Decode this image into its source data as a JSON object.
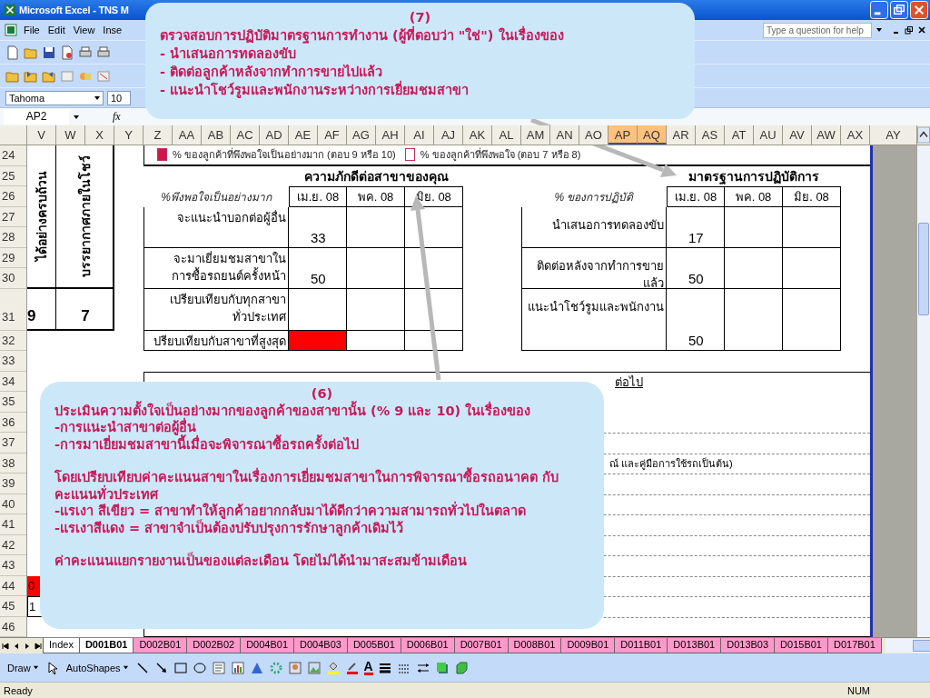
{
  "window": {
    "title": "Microsoft Excel - TNS M"
  },
  "menu": [
    "File",
    "Edit",
    "View",
    "Inse"
  ],
  "help_box": {
    "placeholder": "Type a question for help"
  },
  "formatting": {
    "font": "Tahoma",
    "size": "10"
  },
  "formula_bar": {
    "name_box": "AP2",
    "function_label": "fx"
  },
  "columns": [
    {
      "label": "V",
      "selected": false
    },
    {
      "label": "W",
      "selected": false
    },
    {
      "label": "X",
      "selected": false
    },
    {
      "label": "Y",
      "selected": false
    },
    {
      "label": "Z",
      "selected": false
    },
    {
      "label": "AA",
      "selected": false
    },
    {
      "label": "AB",
      "selected": false
    },
    {
      "label": "AC",
      "selected": false
    },
    {
      "label": "AD",
      "selected": false
    },
    {
      "label": "AE",
      "selected": false
    },
    {
      "label": "AF",
      "selected": false
    },
    {
      "label": "AG",
      "selected": false
    },
    {
      "label": "AH",
      "selected": false
    },
    {
      "label": "AI",
      "selected": false
    },
    {
      "label": "AJ",
      "selected": false
    },
    {
      "label": "AK",
      "selected": false
    },
    {
      "label": "AL",
      "selected": false
    },
    {
      "label": "AM",
      "selected": false
    },
    {
      "label": "AN",
      "selected": false
    },
    {
      "label": "AO",
      "selected": false
    },
    {
      "label": "AP",
      "selected": true
    },
    {
      "label": "AQ",
      "selected": true
    },
    {
      "label": "AR",
      "selected": false
    },
    {
      "label": "AS",
      "selected": false
    },
    {
      "label": "AT",
      "selected": false
    },
    {
      "label": "AU",
      "selected": false
    },
    {
      "label": "AV",
      "selected": false
    },
    {
      "label": "AW",
      "selected": false
    },
    {
      "label": "AX",
      "selected": false
    },
    {
      "label": "AY",
      "selected": false
    }
  ],
  "rows": [
    "24",
    "25",
    "26",
    "27",
    "28",
    "29",
    "30",
    "31",
    "32",
    "33",
    "34",
    "35",
    "36",
    "37",
    "38",
    "39",
    "40",
    "41",
    "42",
    "43",
    "44",
    "45",
    "46"
  ],
  "summary_box": {
    "headings": [
      "ได้อย่างครบถ้วน",
      "บรรยากาศภายในโชว์"
    ],
    "values": [
      "9",
      "7"
    ]
  },
  "legend": [
    {
      "label": "% ของลูกค้าที่พึงพอใจเป็นอย่างมาก (ตอบ 9 หรือ 10)",
      "filled": true
    },
    {
      "label": "% ของลูกค้าที่พึงพอใจ (ตอบ 7 หรือ 8)",
      "filled": false
    }
  ],
  "loyalty_table": {
    "title": "ความภักดีต่อสาขาของคุณ",
    "caption": "%พึงพอใจเป็นอย่างมาก",
    "months": [
      "เม.ย. 08",
      "พค. 08",
      "มิย. 08"
    ],
    "rows": [
      {
        "lines": [
          "จะแนะนำบอกต่อผู้อื่น"
        ],
        "value": "33"
      },
      {
        "lines": [
          "จะมาเยี่ยมชมสาขาใน",
          "การซื้อรถยนต์ครั้งหน้า"
        ],
        "value": "50"
      },
      {
        "lines": [
          "เปรียบเทียบกับทุกสาขา",
          "ทั่วประเทศ"
        ]
      },
      {
        "lines": [
          "ปรียบเทียบกับสาขาที่สูงสุด"
        ],
        "color": "#ff0000"
      }
    ]
  },
  "standards_table": {
    "title": "มาตรฐานการปฏิบัติการ",
    "caption": "% ของการปฏิบัติ",
    "months": [
      "เม.ย. 08",
      "พค. 08",
      "มิย. 08"
    ],
    "rows": [
      {
        "lines": [
          "นำเสนอการทดลองขับ"
        ],
        "value": "17"
      },
      {
        "lines": [
          "ติดต่อหลังจากทำการขาย",
          "แล้ว"
        ],
        "value": "50"
      },
      {
        "lines": [
          "แนะนำโชว์รูมและพนักงาน"
        ],
        "value": "50"
      }
    ]
  },
  "notes_box": {
    "heading": "ต่อไป",
    "fragment": "ณ์ และคู่มือการใช้รถเป็นต้น)"
  },
  "side_cells": [
    {
      "text": "0",
      "color": "#ff0000"
    },
    {
      "text": "1",
      "color": "#ffffff"
    }
  ],
  "sheet_tabs": [
    {
      "label": "Index",
      "selected": false,
      "color": "#ffffff"
    },
    {
      "label": "D001B01",
      "selected": true,
      "color": "#ffffff"
    },
    {
      "label": "D002B01",
      "selected": false,
      "color": "#ff99cc"
    },
    {
      "label": "D002B02",
      "selected": false,
      "color": "#ff99cc"
    },
    {
      "label": "D004B01",
      "selected": false,
      "color": "#ff99cc"
    },
    {
      "label": "D004B03",
      "selected": false,
      "color": "#ff99cc"
    },
    {
      "label": "D005B01",
      "selected": false,
      "color": "#ff99cc"
    },
    {
      "label": "D006B01",
      "selected": false,
      "color": "#ff99cc"
    },
    {
      "label": "D007B01",
      "selected": false,
      "color": "#ff99cc"
    },
    {
      "label": "D008B01",
      "selected": false,
      "color": "#ff99cc"
    },
    {
      "label": "D009B01",
      "selected": false,
      "color": "#ff99cc"
    },
    {
      "label": "D011B01",
      "selected": false,
      "color": "#ff99cc"
    },
    {
      "label": "D013B01",
      "selected": false,
      "color": "#ff99cc"
    },
    {
      "label": "D013B03",
      "selected": false,
      "color": "#ff99cc"
    },
    {
      "label": "D015B01",
      "selected": false,
      "color": "#ff99cc"
    },
    {
      "label": "D017B01",
      "selected": false,
      "color": "#ff99cc"
    }
  ],
  "draw_toolbar": {
    "draw": "Draw",
    "autoshapes": "AutoShapes",
    "font_color": "A"
  },
  "status_bar": {
    "text": "Ready",
    "num": "NUM"
  },
  "callouts": [
    {
      "number": "(7)",
      "paragraphs": [
        [
          "ตรวจสอบการปฏิบัติมาตรฐานการทำงาน (ผู้ที่ตอบว่า \"ใช่\") ในเรื่องของ",
          "- นำเสนอการทดลองขับ",
          "- ติดต่อลูกค้าหลังจากทำการขายไปแล้ว",
          "- แนะนำโชว์รูมและพนักงานระหว่างการเยี่ยมชมสาขา"
        ]
      ]
    },
    {
      "number": "(6)",
      "paragraphs": [
        [
          "ประเมินความตั้งใจเป็นอย่างมากของลูกค้าของสาขานั้น (% 9 และ 10)  ในเรื่องของ",
          "-การแนะนำสาขาต่อผู้อื่น",
          "-การมาเยี่ยมชมสาขานี้เมื่อจะพิจารณาซื้อรถครั้งต่อไป"
        ],
        [
          "โดยเปรียบเทียบค่าคะแนนสาขาในเรื่องการเยี่ยมชมสาขาในการพิจารณาซื้อรถอนาคต กับ คะแนนทั่วประเทศ",
          "-แรเงา สีเขียว = สาขาทำให้ลูกค้าอยากกลับมาได้ดีกว่าความสามารถทั่วไปในตลาด",
          "-แรเงาสีแดง = สาขาจำเป็นต้องปรับปรุงการรักษาลูกค้าเดิมไว้"
        ],
        [
          "ค่าคะแนนแยกรายงานเป็นของแต่ละเดือน โดยไม่ได้นำมาสะสมข้ามเดือน"
        ]
      ]
    }
  ]
}
